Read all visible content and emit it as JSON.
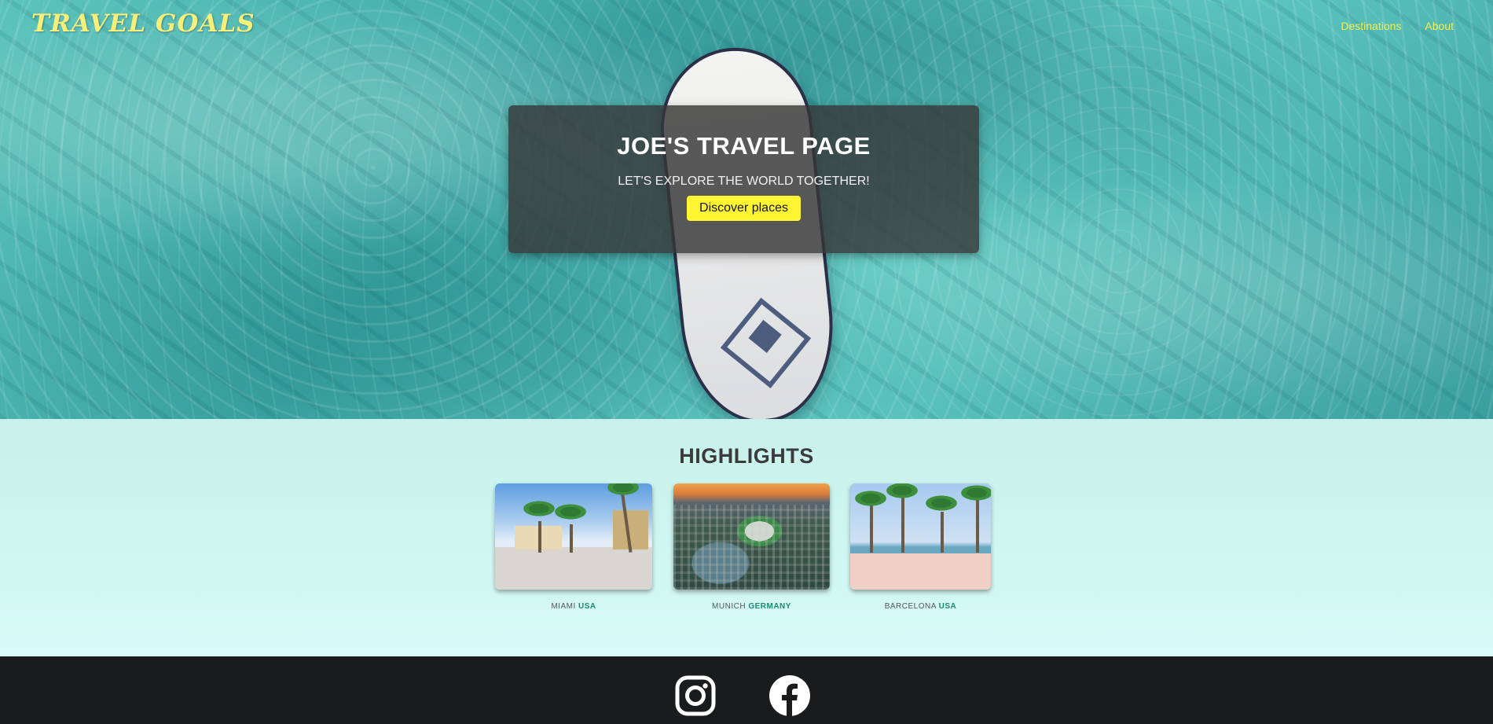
{
  "header": {
    "logo": "TRAVEL GOALS",
    "nav": [
      "Destinations",
      "About"
    ]
  },
  "hero": {
    "title": "JOE'S TRAVEL PAGE",
    "subtitle": "LET'S EXPLORE THE WORLD TOGETHER!",
    "cta_label": "Discover places"
  },
  "highlights": {
    "title": "HIGHLIGHTS",
    "cards": [
      {
        "city": "MIAMI",
        "country": "USA"
      },
      {
        "city": "MUNICH",
        "country": "GERMANY"
      },
      {
        "city": "BARCELONA",
        "country": "USA"
      }
    ]
  },
  "footer": {
    "icons": [
      "instagram-icon",
      "facebook-icon"
    ]
  },
  "colors": {
    "logo": "#f6ef7a",
    "nav": "#f6ef4a",
    "cta_bg": "#fff533",
    "country_accent": "#1b8a73",
    "footer_bg": "#1a1b1c"
  }
}
